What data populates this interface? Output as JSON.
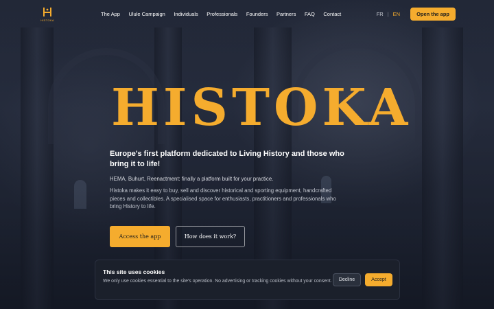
{
  "brand": {
    "logo_text": "HISTOKA",
    "accent": "#f5ac2e"
  },
  "nav": {
    "items": [
      {
        "label": "The App"
      },
      {
        "label": "Ulule Campaign"
      },
      {
        "label": "Individuals"
      },
      {
        "label": "Professionals"
      },
      {
        "label": "Founders"
      },
      {
        "label": "Partners"
      },
      {
        "label": "FAQ"
      },
      {
        "label": "Contact"
      }
    ],
    "lang_fr": "FR",
    "lang_sep": "|",
    "lang_en": "EN",
    "open_app_label": "Open the app"
  },
  "hero": {
    "title": "HISTOKA",
    "tagline": "Europe's first platform dedicated to Living History and those who bring it to life!",
    "subline": "HEMA, Buhurt, Reenactment: finally a platform built for your practice.",
    "description": "Histoka makes it easy to buy, sell and discover historical and sporting equipment, handcrafted pieces and collectibles. A specialised space for enthusiasts, practitioners and professionals who bring History to life.",
    "primary_cta": "Access the app",
    "secondary_cta": "How does it work?"
  },
  "cookie": {
    "title": "This site uses cookies",
    "text": "We only use cookies essential to the site's operation. No advertising or tracking cookies without your consent.",
    "decline_label": "Decline",
    "accept_label": "Accept"
  }
}
